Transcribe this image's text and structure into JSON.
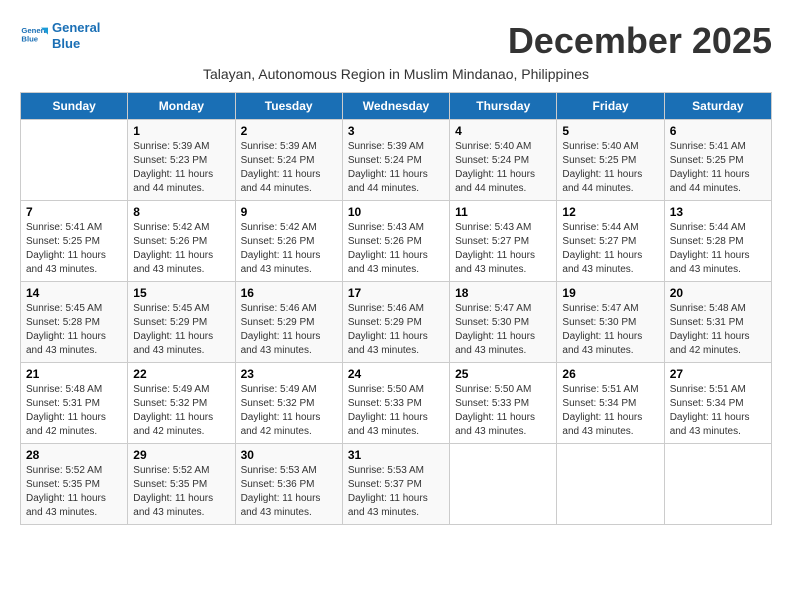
{
  "header": {
    "logo_line1": "General",
    "logo_line2": "Blue",
    "month_title": "December 2025",
    "subtitle": "Talayan, Autonomous Region in Muslim Mindanao, Philippines"
  },
  "days_of_week": [
    "Sunday",
    "Monday",
    "Tuesday",
    "Wednesday",
    "Thursday",
    "Friday",
    "Saturday"
  ],
  "weeks": [
    [
      {
        "day": "",
        "info": ""
      },
      {
        "day": "1",
        "info": "Sunrise: 5:39 AM\nSunset: 5:23 PM\nDaylight: 11 hours\nand 44 minutes."
      },
      {
        "day": "2",
        "info": "Sunrise: 5:39 AM\nSunset: 5:24 PM\nDaylight: 11 hours\nand 44 minutes."
      },
      {
        "day": "3",
        "info": "Sunrise: 5:39 AM\nSunset: 5:24 PM\nDaylight: 11 hours\nand 44 minutes."
      },
      {
        "day": "4",
        "info": "Sunrise: 5:40 AM\nSunset: 5:24 PM\nDaylight: 11 hours\nand 44 minutes."
      },
      {
        "day": "5",
        "info": "Sunrise: 5:40 AM\nSunset: 5:25 PM\nDaylight: 11 hours\nand 44 minutes."
      },
      {
        "day": "6",
        "info": "Sunrise: 5:41 AM\nSunset: 5:25 PM\nDaylight: 11 hours\nand 44 minutes."
      }
    ],
    [
      {
        "day": "7",
        "info": "Sunrise: 5:41 AM\nSunset: 5:25 PM\nDaylight: 11 hours\nand 43 minutes."
      },
      {
        "day": "8",
        "info": "Sunrise: 5:42 AM\nSunset: 5:26 PM\nDaylight: 11 hours\nand 43 minutes."
      },
      {
        "day": "9",
        "info": "Sunrise: 5:42 AM\nSunset: 5:26 PM\nDaylight: 11 hours\nand 43 minutes."
      },
      {
        "day": "10",
        "info": "Sunrise: 5:43 AM\nSunset: 5:26 PM\nDaylight: 11 hours\nand 43 minutes."
      },
      {
        "day": "11",
        "info": "Sunrise: 5:43 AM\nSunset: 5:27 PM\nDaylight: 11 hours\nand 43 minutes."
      },
      {
        "day": "12",
        "info": "Sunrise: 5:44 AM\nSunset: 5:27 PM\nDaylight: 11 hours\nand 43 minutes."
      },
      {
        "day": "13",
        "info": "Sunrise: 5:44 AM\nSunset: 5:28 PM\nDaylight: 11 hours\nand 43 minutes."
      }
    ],
    [
      {
        "day": "14",
        "info": "Sunrise: 5:45 AM\nSunset: 5:28 PM\nDaylight: 11 hours\nand 43 minutes."
      },
      {
        "day": "15",
        "info": "Sunrise: 5:45 AM\nSunset: 5:29 PM\nDaylight: 11 hours\nand 43 minutes."
      },
      {
        "day": "16",
        "info": "Sunrise: 5:46 AM\nSunset: 5:29 PM\nDaylight: 11 hours\nand 43 minutes."
      },
      {
        "day": "17",
        "info": "Sunrise: 5:46 AM\nSunset: 5:29 PM\nDaylight: 11 hours\nand 43 minutes."
      },
      {
        "day": "18",
        "info": "Sunrise: 5:47 AM\nSunset: 5:30 PM\nDaylight: 11 hours\nand 43 minutes."
      },
      {
        "day": "19",
        "info": "Sunrise: 5:47 AM\nSunset: 5:30 PM\nDaylight: 11 hours\nand 43 minutes."
      },
      {
        "day": "20",
        "info": "Sunrise: 5:48 AM\nSunset: 5:31 PM\nDaylight: 11 hours\nand 42 minutes."
      }
    ],
    [
      {
        "day": "21",
        "info": "Sunrise: 5:48 AM\nSunset: 5:31 PM\nDaylight: 11 hours\nand 42 minutes."
      },
      {
        "day": "22",
        "info": "Sunrise: 5:49 AM\nSunset: 5:32 PM\nDaylight: 11 hours\nand 42 minutes."
      },
      {
        "day": "23",
        "info": "Sunrise: 5:49 AM\nSunset: 5:32 PM\nDaylight: 11 hours\nand 42 minutes."
      },
      {
        "day": "24",
        "info": "Sunrise: 5:50 AM\nSunset: 5:33 PM\nDaylight: 11 hours\nand 43 minutes."
      },
      {
        "day": "25",
        "info": "Sunrise: 5:50 AM\nSunset: 5:33 PM\nDaylight: 11 hours\nand 43 minutes."
      },
      {
        "day": "26",
        "info": "Sunrise: 5:51 AM\nSunset: 5:34 PM\nDaylight: 11 hours\nand 43 minutes."
      },
      {
        "day": "27",
        "info": "Sunrise: 5:51 AM\nSunset: 5:34 PM\nDaylight: 11 hours\nand 43 minutes."
      }
    ],
    [
      {
        "day": "28",
        "info": "Sunrise: 5:52 AM\nSunset: 5:35 PM\nDaylight: 11 hours\nand 43 minutes."
      },
      {
        "day": "29",
        "info": "Sunrise: 5:52 AM\nSunset: 5:35 PM\nDaylight: 11 hours\nand 43 minutes."
      },
      {
        "day": "30",
        "info": "Sunrise: 5:53 AM\nSunset: 5:36 PM\nDaylight: 11 hours\nand 43 minutes."
      },
      {
        "day": "31",
        "info": "Sunrise: 5:53 AM\nSunset: 5:37 PM\nDaylight: 11 hours\nand 43 minutes."
      },
      {
        "day": "",
        "info": ""
      },
      {
        "day": "",
        "info": ""
      },
      {
        "day": "",
        "info": ""
      }
    ]
  ]
}
